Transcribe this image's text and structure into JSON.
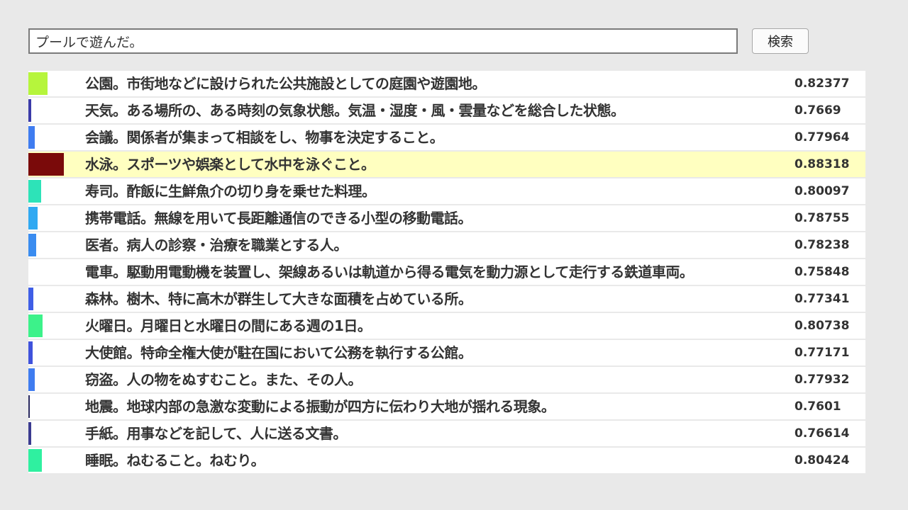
{
  "search": {
    "query": "プールで遊んだ。",
    "button_label": "検索"
  },
  "results": [
    {
      "text": "公園。市街地などに設けられた公共施設としての庭園や遊園地。",
      "score": "0.82377",
      "bar_color": "#b6f53c",
      "top": false
    },
    {
      "text": "天気。ある場所の、ある時刻の気象状態。気温・湿度・風・雲量などを総合した状態。",
      "score": "0.7669",
      "bar_color": "#3b3ba8",
      "top": false
    },
    {
      "text": "会議。関係者が集まって相談をし、物事を決定すること。",
      "score": "0.77964",
      "bar_color": "#3f7cf0",
      "top": false
    },
    {
      "text": "水泳。スポーツや娯楽として水中を泳ぐこと。",
      "score": "0.88318",
      "bar_color": "#7a0a0a",
      "top": true
    },
    {
      "text": "寿司。酢飯に生鮮魚介の切り身を乗せた料理。",
      "score": "0.80097",
      "bar_color": "#2de3b8",
      "top": false
    },
    {
      "text": "携帯電話。無線を用いて長距離通信のできる小型の移動電話。",
      "score": "0.78755",
      "bar_color": "#30a9f2",
      "top": false
    },
    {
      "text": "医者。病人の診察・治療を職業とする人。",
      "score": "0.78238",
      "bar_color": "#3a8cf0",
      "top": false
    },
    {
      "text": "電車。駆動用電動機を装置し、架線あるいは軌道から得る電気を動力源として走行する鉄道車両。",
      "score": "0.75848",
      "bar_color": "#ffffff",
      "top": false
    },
    {
      "text": "森林。樹木、特に高木が群生して大きな面積を占めている所。",
      "score": "0.77341",
      "bar_color": "#3f5ee6",
      "top": false
    },
    {
      "text": "火曜日。月曜日と水曜日の間にある週の1日。",
      "score": "0.80738",
      "bar_color": "#3cf28a",
      "top": false
    },
    {
      "text": "大使館。特命全権大使が駐在国において公務を執行する公館。",
      "score": "0.77171",
      "bar_color": "#3f52dc",
      "top": false
    },
    {
      "text": "窃盗。人の物をぬすむこと。また、その人。",
      "score": "0.77932",
      "bar_color": "#3f7cf0",
      "top": false
    },
    {
      "text": "地震。地球内部の急激な変動による振動が四方に伝わり大地が揺れる現象。",
      "score": "0.7601",
      "bar_color": "#2a2a60",
      "top": false
    },
    {
      "text": "手紙。用事などを記して、人に送る文書。",
      "score": "0.76614",
      "bar_color": "#3b3b90",
      "top": false
    },
    {
      "text": "睡眠。ねむること。ねむり。",
      "score": "0.80424",
      "bar_color": "#2ff0a0",
      "top": false
    }
  ]
}
